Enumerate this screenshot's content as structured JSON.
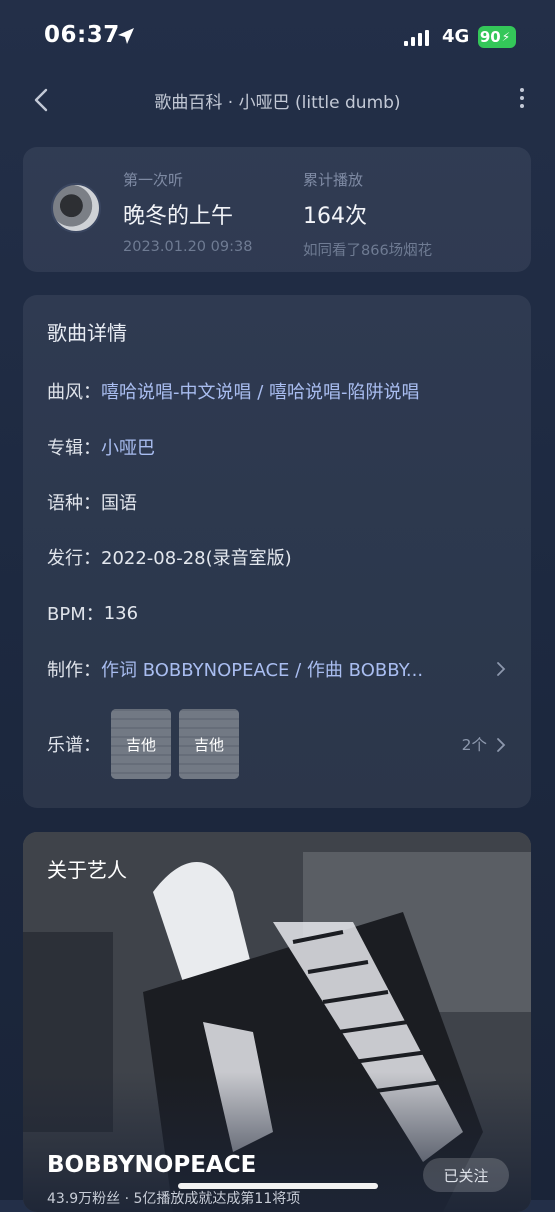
{
  "status_bar": {
    "time": "06:37",
    "network": "4G",
    "battery": "90"
  },
  "nav": {
    "title": "歌曲百科 · 小哑巴 (little dumb)"
  },
  "first_listen": {
    "label": "第一次听",
    "value": "晚冬的上午",
    "date": "2023.01.20 09:38"
  },
  "play_count": {
    "label": "累计播放",
    "value": "164次",
    "note": "如同看了866场烟花"
  },
  "details": {
    "title": "歌曲详情",
    "rows": [
      {
        "label": "曲风：",
        "value": "嘻哈说唱-中文说唱 / 嘻哈说唱-陷阱说唱"
      },
      {
        "label": "专辑：",
        "value": "小哑巴"
      },
      {
        "label": "语种：",
        "value": "国语"
      },
      {
        "label": "发行：",
        "value": "2022-08-28(录音室版)"
      },
      {
        "label": "BPM：",
        "value": "136"
      },
      {
        "label": "制作：",
        "value": "作词 BOBBYNOPEACE / 作曲 BOBBY..."
      }
    ],
    "score_label": "乐谱：",
    "scores": [
      "吉他",
      "吉他"
    ],
    "score_count": "2个"
  },
  "artist": {
    "title": "关于艺人",
    "name": "BOBBYNOPEACE",
    "follow_label": "已关注",
    "description": "43.9万粉丝 · 5亿播放成就达成第11将项"
  },
  "colors": {
    "accent_link": "#a9bdf0",
    "battery_green": "#34c759"
  }
}
